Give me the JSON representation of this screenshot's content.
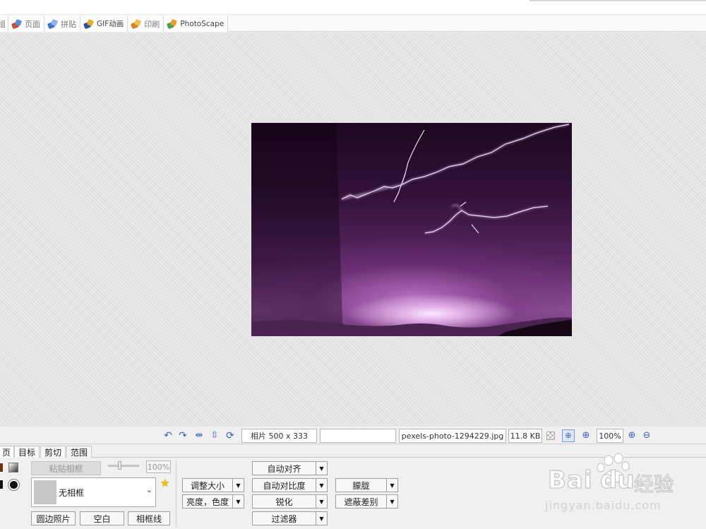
{
  "tabs": [
    {
      "label": "组",
      "icon": "tab-icon"
    },
    {
      "label": "页面",
      "icon": "page-icon"
    },
    {
      "label": "拼贴",
      "icon": "combine-icon"
    },
    {
      "label": "GIF动画",
      "icon": "gif-icon"
    },
    {
      "label": "印刷",
      "icon": "print-icon"
    },
    {
      "label": "PhotoScape",
      "icon": "photoscape-icon"
    }
  ],
  "status": {
    "photo_size": "相片 500 x 333",
    "empty": "",
    "filename": "pexels-photo-1294229.jpg",
    "filesize": "11.8 KB",
    "zoom": "100%"
  },
  "panel": {
    "tabs": [
      "页",
      "目标",
      "剪切",
      "范围"
    ],
    "paste_frame": "粘贴相框",
    "slider_value": "100%",
    "frame_select": "无相框",
    "round_photo": "圆边照片",
    "blank": "空白",
    "frame_line": "相框线",
    "resize": "调整大小",
    "brightness": "亮度，色度",
    "auto_align": "自动对齐",
    "auto_contrast": "自动对比度",
    "sharpen": "锐化",
    "filter": "过滤器",
    "blur": "朦胧",
    "backlight": "遮蔽差别"
  },
  "watermark": {
    "brand": "Bai",
    "brand_cn": "经验",
    "url": "jingyan.baidu.com"
  },
  "colors": {
    "accent_blue": "#3a66b0",
    "photo_purple": "#5a2763"
  }
}
